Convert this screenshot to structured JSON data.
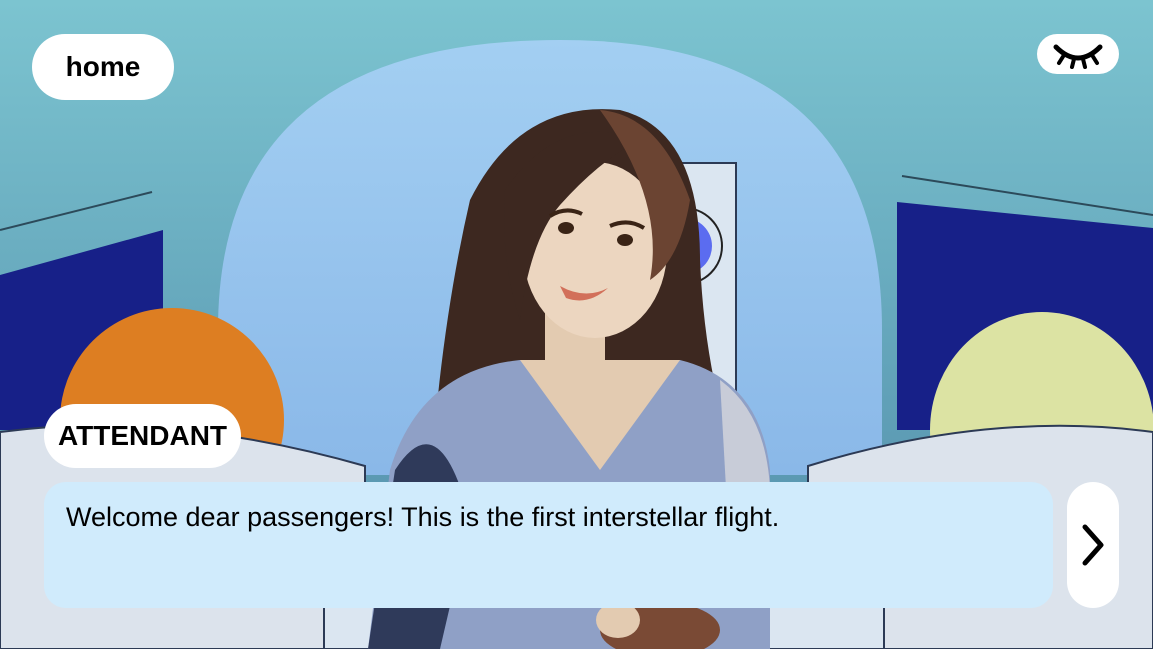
{
  "nav": {
    "home_label": "home",
    "hide_ui_icon": "closed-eye-icon"
  },
  "dialogue": {
    "speaker": "ATTENDANT",
    "line": "Welcome dear passengers! This is the first interstellar flight."
  },
  "controls": {
    "next_icon": "chevron-right-icon"
  },
  "colors": {
    "sky": "#7cc4d0",
    "cabin_arch": "#9fcaf0",
    "seat_navy": "#172088",
    "seat_orange": "#dd7e22",
    "seat_yellow": "#dce3a3",
    "dialog_bg": "#d0ebfc",
    "porthole": "#5b6cf0"
  }
}
